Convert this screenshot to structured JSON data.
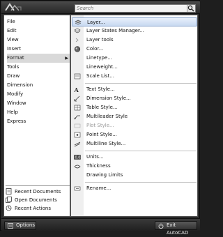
{
  "search": {
    "placeholder": "Search"
  },
  "left_menu": [
    {
      "label": "File"
    },
    {
      "label": "Edit"
    },
    {
      "label": "View"
    },
    {
      "label": "Insert"
    },
    {
      "label": "Format",
      "active": true,
      "arrow": "▶"
    },
    {
      "label": "Tools"
    },
    {
      "label": "Draw"
    },
    {
      "label": "Dimension"
    },
    {
      "label": "Modify"
    },
    {
      "label": "Window"
    },
    {
      "label": "Help"
    },
    {
      "label": "Express"
    }
  ],
  "recent": [
    {
      "label": "Recent Documents",
      "icon": "recent-documents-icon"
    },
    {
      "label": "Open Documents",
      "icon": "open-documents-icon"
    },
    {
      "label": "Recent Actions",
      "icon": "recent-actions-icon"
    }
  ],
  "format_menu": {
    "group1": [
      {
        "label": "Layer...",
        "icon": "layer-icon",
        "highlighted": true
      },
      {
        "label": "Layer States Manager...",
        "icon": "layer-states-icon"
      },
      {
        "label": "Layer tools",
        "icon": "layer-tools-icon",
        "submenu": true
      },
      {
        "label": "Color...",
        "icon": "color-icon"
      },
      {
        "label": "Linetype...",
        "icon": ""
      },
      {
        "label": "Lineweight...",
        "icon": ""
      },
      {
        "label": "Scale List...",
        "icon": "scale-list-icon"
      }
    ],
    "group2": [
      {
        "label": "Text Style...",
        "icon": "text-style-icon"
      },
      {
        "label": "Dimension Style...",
        "icon": "dimension-style-icon"
      },
      {
        "label": "Table Style...",
        "icon": "table-style-icon"
      },
      {
        "label": "Multileader Style",
        "icon": "multileader-style-icon"
      },
      {
        "label": "Plot Style...",
        "icon": "plot-style-icon",
        "disabled": true
      },
      {
        "label": "Point Style...",
        "icon": "point-style-icon"
      },
      {
        "label": "Multiline Style...",
        "icon": "multiline-style-icon"
      }
    ],
    "group3": [
      {
        "label": "Units...",
        "icon": "units-icon"
      },
      {
        "label": "Thickness",
        "icon": "thickness-icon"
      },
      {
        "label": "Drawing Limits",
        "icon": ""
      }
    ],
    "group4": [
      {
        "label": "Rename...",
        "icon": "rename-icon"
      }
    ]
  },
  "bottom": {
    "options_label": "Options",
    "exit_label": "Exit AutoCAD"
  },
  "colors": {
    "highlight": "#c7d9f1",
    "dark_chrome": "#2a2a2a"
  }
}
